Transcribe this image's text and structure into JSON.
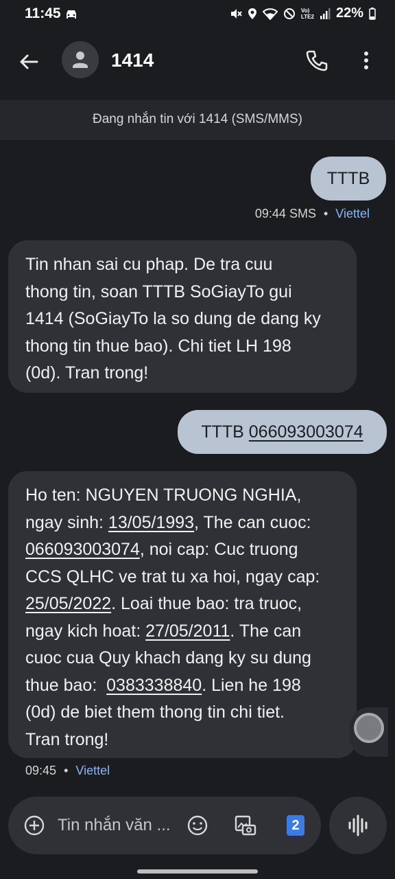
{
  "status_bar": {
    "time": "11:45",
    "volte": "Vo)\nLTE2",
    "battery": "22%"
  },
  "header": {
    "contact_name": "1414"
  },
  "banner": {
    "text": "Đang nhắn tin với 1414 (SMS/MMS)"
  },
  "messages": [
    {
      "direction": "outgoing",
      "text": "TTTB",
      "meta": {
        "time": "09:44",
        "type": "SMS",
        "separator": "•",
        "carrier": "Viettel"
      }
    },
    {
      "direction": "incoming",
      "lines": [
        "Tin nhan sai cu phap. De tra cuu",
        "thong tin, soan TTTB SoGiayTo gui",
        "1414 (SoGiayTo la so dung de dang ky",
        "thong tin thue bao). Chi tiet LH 198",
        "(0d). Tran trong!"
      ]
    },
    {
      "direction": "outgoing",
      "prefix": "TTTB ",
      "link": "066093003074"
    },
    {
      "direction": "incoming",
      "segments": [
        {
          "t": "Ho ten: NGUYEN TRUONG NGHIA,"
        },
        {
          "t": "ngay sinh: "
        },
        {
          "t": "13/05/1993",
          "link": true
        },
        {
          "t": ", The can cuoc:"
        },
        {
          "t": "066093003074",
          "link": true
        },
        {
          "t": ", noi cap: Cuc truong"
        },
        {
          "t": "CCS QLHC ve trat tu xa hoi, ngay cap:"
        },
        {
          "t": "25/05/2022",
          "link": true
        },
        {
          "t": ". Loai thue bao: tra truoc,"
        },
        {
          "t": "ngay kich hoat: "
        },
        {
          "t": "27/05/2011",
          "link": true
        },
        {
          "t": ". The can"
        },
        {
          "t": "cuoc cua Quy khach dang ky su dung"
        },
        {
          "t": "thue bao:  "
        },
        {
          "t": "0383338840",
          "link": true
        },
        {
          "t": ". Lien he 198"
        },
        {
          "t": "(0d) de biet them thong tin chi tiet."
        },
        {
          "t": "Tran trong!"
        }
      ],
      "meta": {
        "time": "09:45",
        "separator": "•",
        "carrier": "Viettel"
      }
    }
  ],
  "composer": {
    "placeholder": "Tin nhắn văn ...",
    "sim_number": "2"
  },
  "colors": {
    "background": "#1b1c20",
    "outgoing_bubble": "#b8c4d2",
    "incoming_bubble": "#303136",
    "carrier_link": "#8ab4f8",
    "sim_badge": "#3d7be0"
  },
  "icons": [
    "car-icon",
    "mute-icon",
    "location-icon",
    "wifi-icon",
    "dnd-icon",
    "signal-icon",
    "battery-icon",
    "back-arrow-icon",
    "person-icon",
    "phone-icon",
    "more-vert-icon",
    "add-circle-icon",
    "emoji-icon",
    "gallery-icon",
    "voice-icon"
  ]
}
